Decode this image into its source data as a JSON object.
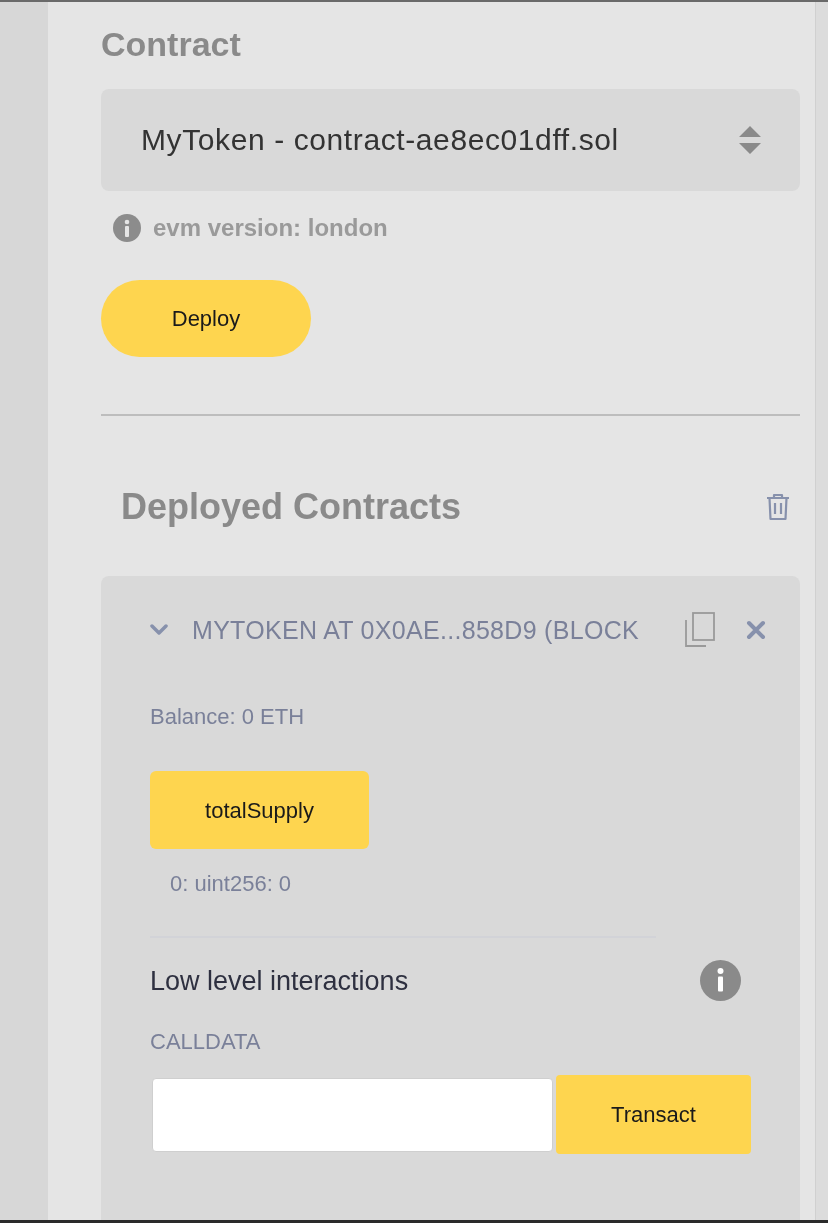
{
  "contract_section": {
    "title": "Contract",
    "select": {
      "value": "MyToken - contract-ae8ec01dff.sol"
    },
    "evm_info": "evm version: london",
    "deploy_button": "Deploy"
  },
  "deployed_section": {
    "title": "Deployed Contracts",
    "instances": [
      {
        "title": "MYTOKEN AT 0X0AE...858D9 (BLOCK",
        "expanded": true,
        "balance": "Balance: 0 ETH",
        "functions": [
          {
            "label": "totalSupply",
            "results": [
              "0: uint256: 0"
            ]
          }
        ],
        "low_level": {
          "title": "Low level interactions",
          "calldata_label": "CALLDATA",
          "transact_button": "Transact"
        }
      }
    ]
  }
}
